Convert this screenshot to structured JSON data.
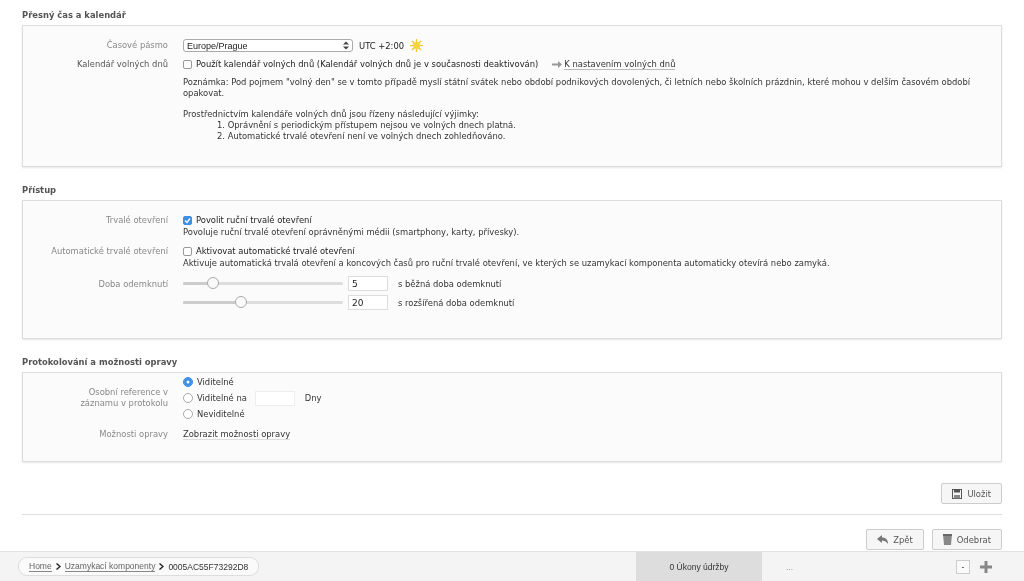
{
  "time_calendar": {
    "title": "Přesný čas a kalendář",
    "timezone": {
      "label": "Časové pásmo",
      "value": "Europe/Prague",
      "offset": "UTC +2:00"
    },
    "holiday": {
      "label": "Kalendář volných dnů",
      "checkbox_label": "Použít kalendář volných dnů (Kalendář volných dnů je v současnosti deaktivován)",
      "checked": false,
      "link": "K nastavením volných dnů"
    },
    "note": "Poznámka: Pod pojmem \"volný den\" se v tomto případě myslí státní svátek nebo období podnikových dovolených, či letních nebo školních prázdnin, které mohou v delším časovém období opakovat.",
    "exceptions_intro": "Prostřednictvím kalendáře volných dnů jsou řízeny následující výjimky:",
    "exceptions": [
      "1. Oprávnění s periodickým přístupem nejsou ve volných dnech platná.",
      "2. Automatické trvalé otevření není ve volných dnech zohledňováno."
    ]
  },
  "access": {
    "title": "Přístup",
    "options": [
      {
        "label": "Trvalé otevření",
        "checkbox_label": "Povolit ruční trvalé otevření",
        "checked": true,
        "description": "Povoluje ruční trvalé otevření oprávněnými médii (smartphony, karty, přívesky)."
      },
      {
        "label": "Automatické trvalé otevření",
        "checkbox_label": "Aktivovat automatické trvalé otevření",
        "checked": false,
        "description": "Aktivuje automatická trvalá otevření a koncových časů pro ruční trvalé otevření, ve kterých se uzamykací komponenta automaticky otevírá nebo zamyká."
      }
    ],
    "unlock_label": "Doba odemknutí",
    "sliders": [
      {
        "level": 0.19,
        "value": "5",
        "caption": "s běžná doba odemknutí"
      },
      {
        "level": 0.36,
        "value": "20",
        "caption": "s rozšířená doba odemknutí"
      }
    ]
  },
  "logging": {
    "title": "Protokolování a možnosti opravy",
    "reference_label": "Osobní reference v záznamu v protokolu",
    "radios": [
      {
        "label": "Viditelné",
        "selected": true
      },
      {
        "label": "Viditelné na",
        "selected": false,
        "unit": "Dny"
      },
      {
        "label": "Neviditelné",
        "selected": false
      }
    ],
    "repair_label": "Možnosti opravy",
    "repair_link": "Zobrazit možnosti opravy"
  },
  "save_button": "Uložit",
  "actions": [
    "Zpět",
    "Odebrat"
  ],
  "status_bar": {
    "breadcrumbs": [
      {
        "label": "Home",
        "link": true
      },
      {
        "label": "Uzamykací komponenty",
        "link": true
      },
      {
        "label": "0005AC55F73292D8",
        "link": false
      }
    ],
    "maintenance": "0 Úkony údržby",
    "more": "...",
    "zoom_out": "-"
  }
}
